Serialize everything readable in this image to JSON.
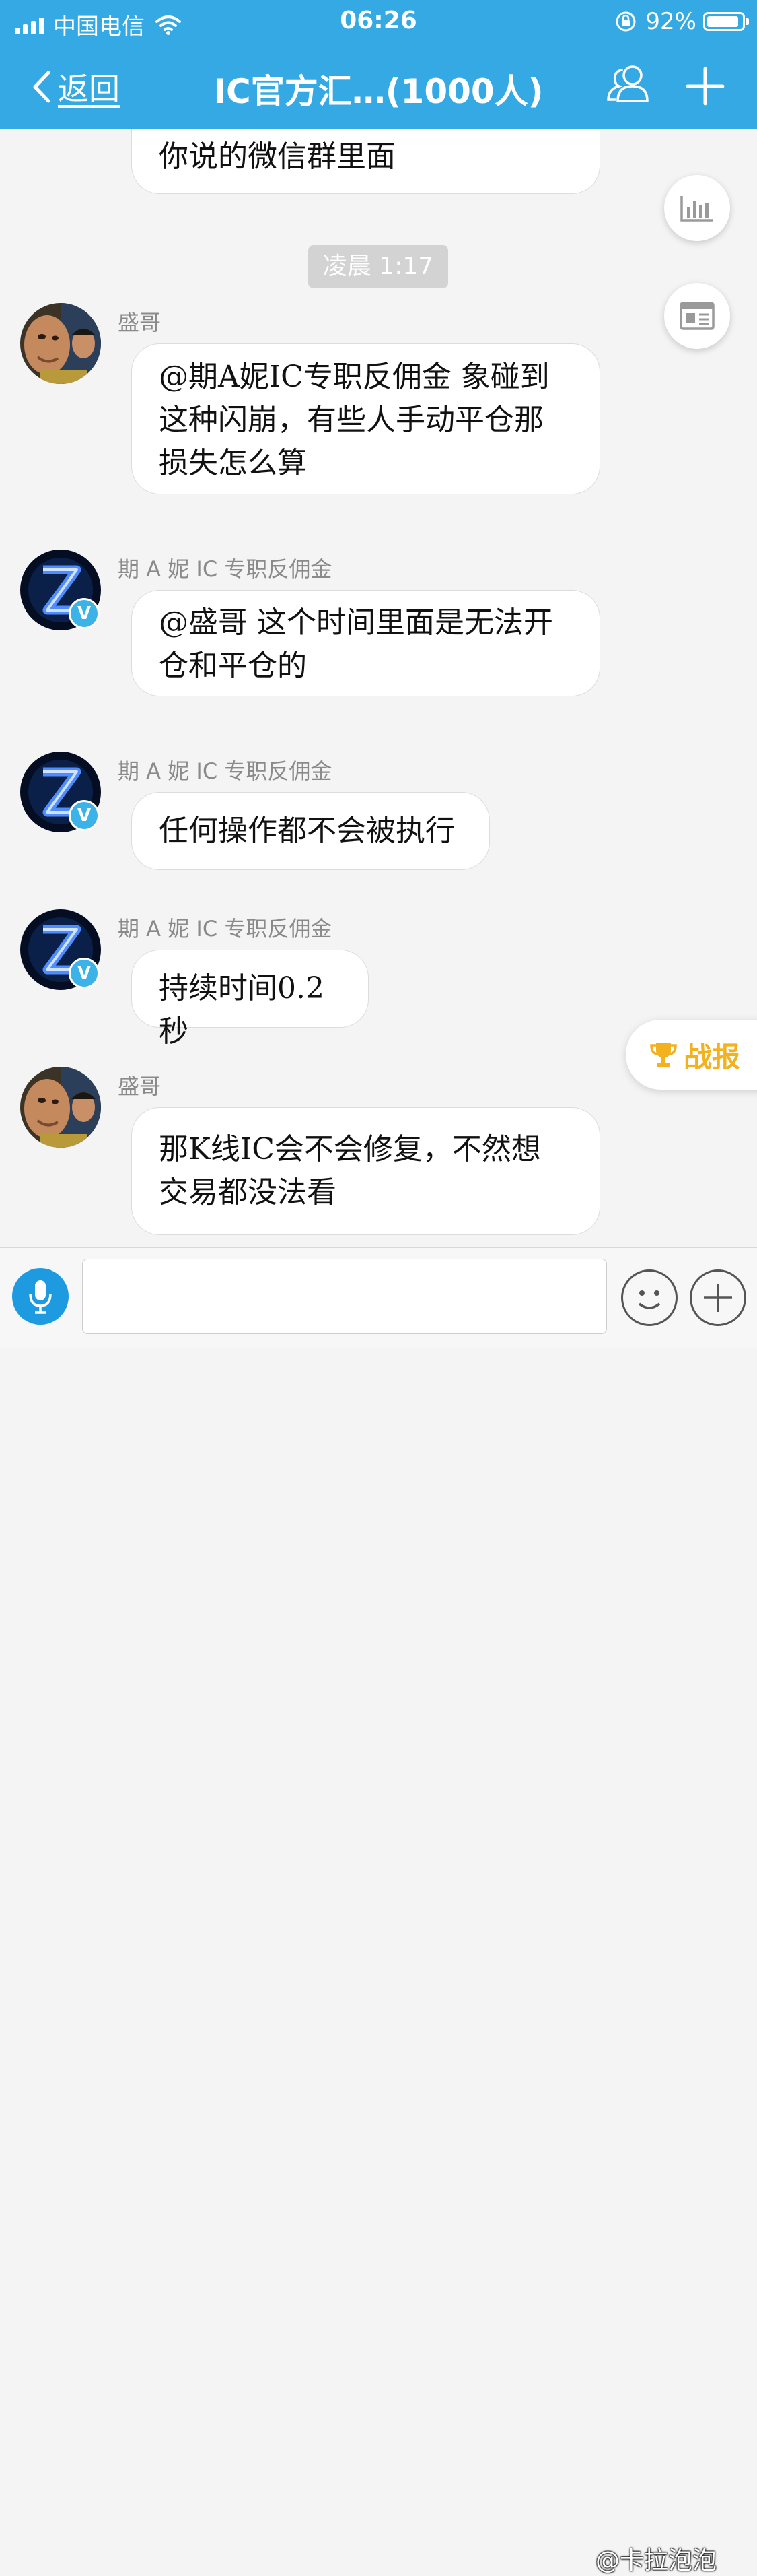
{
  "status_bar": {
    "carrier": "中国电信",
    "time": "06:26",
    "battery_text": "92%",
    "battery_fraction": 0.92
  },
  "nav": {
    "back_label": "返回",
    "title": "IC官方汇…(1000人)"
  },
  "chat": {
    "top_partial_message": "你说的微信群里面",
    "time_divider": "凌晨 1:17",
    "messages": [
      {
        "sender": "盛哥",
        "text_lines": [
          "@期A妮IC专职反佣金 象碰到",
          "这种闪崩，有些人手动平仓那",
          "损失怎么算"
        ]
      },
      {
        "sender": "期 A 妮 IC 专职反佣金",
        "text_lines": [
          "@盛哥 这个时间里面是无法开",
          "仓和平仓的"
        ]
      },
      {
        "sender": "期 A 妮 IC 专职反佣金",
        "text_lines": [
          "任何操作都不会被执行"
        ]
      },
      {
        "sender": "期 A 妮 IC 专职反佣金",
        "text_lines": [
          "持续时间0.2秒"
        ]
      },
      {
        "sender": "盛哥",
        "text_lines": [
          "那K线IC会不会修复，不然想",
          "交易都没法看"
        ]
      }
    ]
  },
  "floating": {
    "zhanbao_label": "战报"
  },
  "input": {
    "value": "",
    "placeholder": ""
  },
  "watermark": "@卡拉泡泡",
  "colors": {
    "header_blue": "#34a9e3",
    "mic_blue": "#1e9be0",
    "verified_badge": "#3bb2e8",
    "zhanbao_gold": "#f3b21d"
  }
}
